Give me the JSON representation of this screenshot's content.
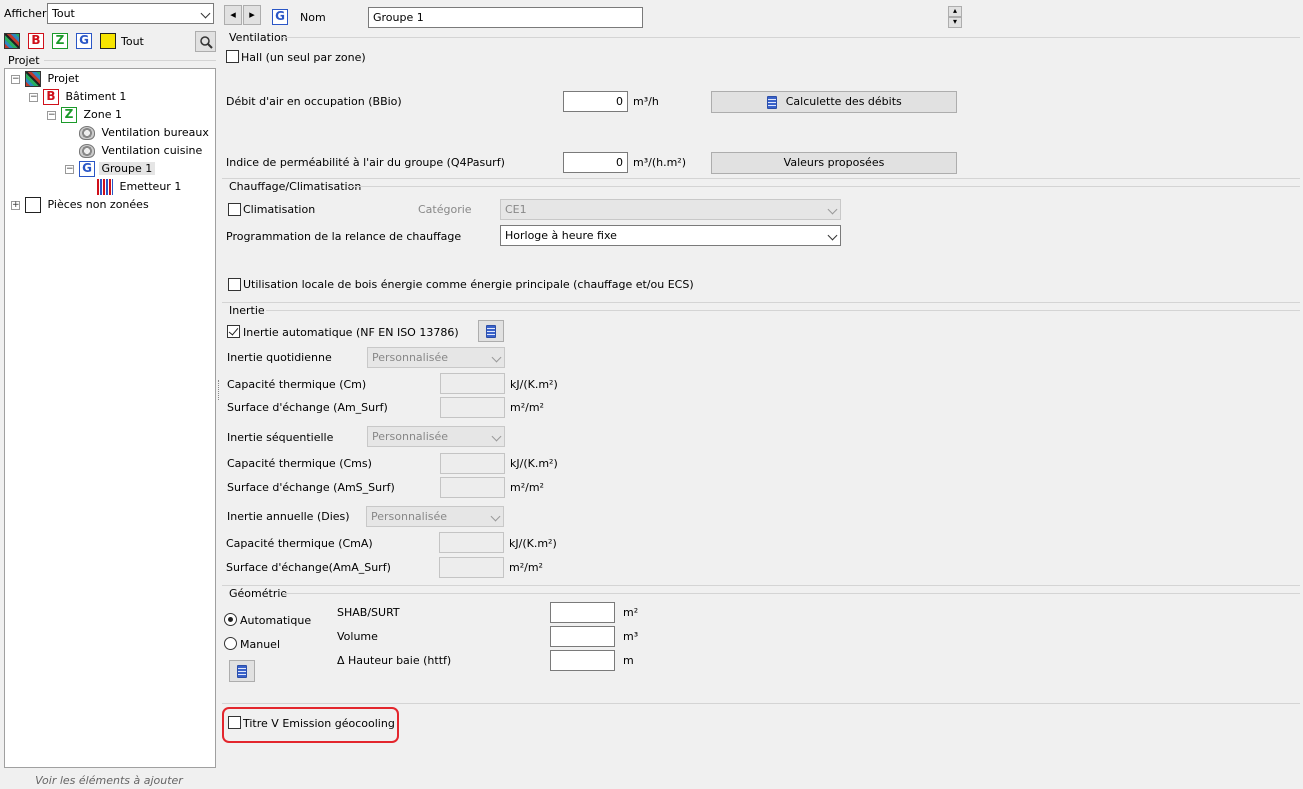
{
  "left": {
    "afficher_label": "Afficher",
    "afficher_value": "Tout",
    "filter_tout": "Tout",
    "tree_header": "Projet",
    "tree": {
      "projet": "Projet",
      "batiment": "Bâtiment 1",
      "zone": "Zone 1",
      "vent_bureaux": "Ventilation bureaux",
      "vent_cuisine": "Ventilation cuisine",
      "groupe": "Groupe 1",
      "emetteur": "Emetteur 1",
      "pieces": "Pièces non zonées"
    },
    "hint": "Voir les éléments à ajouter"
  },
  "top": {
    "nom_label": "Nom",
    "nom_value": "Groupe 1"
  },
  "ventilation": {
    "title": "Ventilation",
    "hall": "Hall (un seul par zone)",
    "debit_label": "Débit d'air en occupation (BBio)",
    "debit_value": "0",
    "debit_unit": "m³/h",
    "calc_button": "Calculette des débits",
    "indice_label": "Indice de perméabilité à l'air du groupe (Q4Pasurf)",
    "indice_value": "0",
    "indice_unit": "m³/(h.m²)",
    "valeurs_button": "Valeurs proposées"
  },
  "chauffage": {
    "title": "Chauffage/Climatisation",
    "climatisation": "Climatisation",
    "categorie_label": "Catégorie",
    "categorie_value": "CE1",
    "prog_label": "Programmation de la relance de chauffage",
    "prog_value": "Horloge à heure fixe",
    "bois": "Utilisation locale de bois énergie comme énergie principale (chauffage et/ou ECS)"
  },
  "inertie": {
    "title": "Inertie",
    "auto": "Inertie automatique (NF EN ISO 13786)",
    "quotidienne": "Inertie quotidienne",
    "quotidienne_value": "Personnalisée",
    "cm_label": "Capacité thermique (Cm)",
    "cm_unit": "kJ/(K.m²)",
    "am_label": "Surface d'échange (Am_Surf)",
    "am_unit": "m²/m²",
    "sequentielle": "Inertie séquentielle",
    "sequentielle_value": "Personnalisée",
    "cms_label": "Capacité thermique (Cms)",
    "cms_unit": "kJ/(K.m²)",
    "ams_label": "Surface d'échange (AmS_Surf)",
    "ams_unit": "m²/m²",
    "annuelle": "Inertie annuelle (Dies)",
    "annuelle_value": "Personnalisée",
    "cma_label": "Capacité thermique (CmA)",
    "cma_unit": "kJ/(K.m²)",
    "ama_label": "Surface d'échange(AmA_Surf)",
    "ama_unit": "m²/m²"
  },
  "geometrie": {
    "title": "Géométrie",
    "automatique": "Automatique",
    "manuel": "Manuel",
    "shab": "SHAB/SURT",
    "shab_unit": "m²",
    "volume": "Volume",
    "volume_unit": "m³",
    "hauteur": "Δ Hauteur baie (httf)",
    "hauteur_unit": "m"
  },
  "titre_v": "Titre V Emission géocooling",
  "colors": {
    "highlight": "#e3262d"
  }
}
